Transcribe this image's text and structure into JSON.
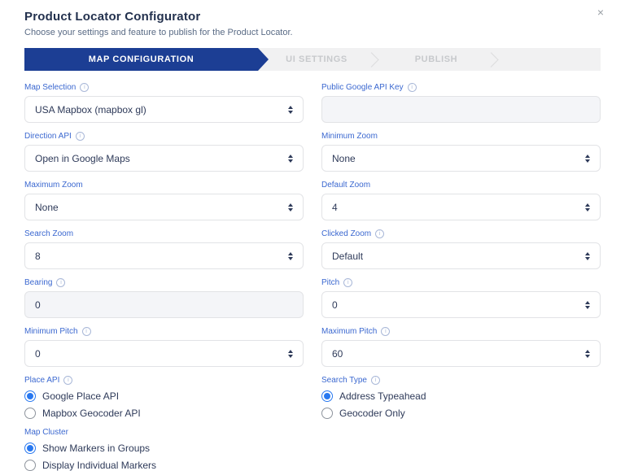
{
  "header": {
    "title": "Product Locator Configurator",
    "subtitle": "Choose your settings and feature to publish for the Product Locator.",
    "close_icon": "×"
  },
  "icons": {
    "info": "i",
    "close": "×"
  },
  "colors": {
    "active_tab_blue": "#1c3e94",
    "label_blue": "#3b68d0",
    "radio_blue": "#2878f0",
    "tabbar_gray": "#f1f1f2",
    "disabled_input_gray": "#f4f5f8"
  },
  "tabs": {
    "items": [
      {
        "label": "MAP CONFIGURATION",
        "active": true
      },
      {
        "label": "UI SETTINGS",
        "active": false
      },
      {
        "label": "PUBLISH",
        "active": false
      }
    ]
  },
  "fields": {
    "map_selection": {
      "label": "Map Selection",
      "value": "USA Mapbox (mapbox gl)"
    },
    "public_google_api_key": {
      "label": "Public Google API Key",
      "value": ""
    },
    "direction_api": {
      "label": "Direction API",
      "value": "Open in Google Maps"
    },
    "minimum_zoom": {
      "label": "Minimum Zoom",
      "value": "None"
    },
    "maximum_zoom": {
      "label": "Maximum Zoom",
      "value": "None"
    },
    "default_zoom": {
      "label": "Default Zoom",
      "value": "4"
    },
    "search_zoom": {
      "label": "Search Zoom",
      "value": "8"
    },
    "clicked_zoom": {
      "label": "Clicked Zoom",
      "value": "Default"
    },
    "bearing": {
      "label": "Bearing",
      "value": "0"
    },
    "pitch": {
      "label": "Pitch",
      "value": "0"
    },
    "minimum_pitch": {
      "label": "Minimum Pitch",
      "value": "0"
    },
    "maximum_pitch": {
      "label": "Maximum Pitch",
      "value": "60"
    },
    "place_api": {
      "label": "Place API",
      "options": [
        "Google Place API",
        "Mapbox Geocoder API"
      ],
      "selected": "Google Place API"
    },
    "search_type": {
      "label": "Search Type",
      "options": [
        "Address Typeahead",
        "Geocoder Only"
      ],
      "selected": "Address Typeahead"
    },
    "map_cluster": {
      "label": "Map Cluster",
      "options": [
        "Show Markers in Groups",
        "Display Individual Markers"
      ],
      "selected": "Show Markers in Groups"
    }
  }
}
